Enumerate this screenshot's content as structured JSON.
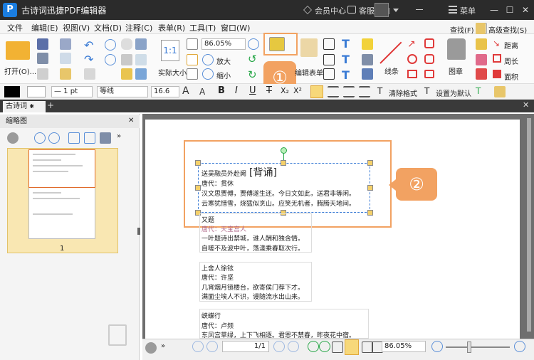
{
  "window": {
    "title": "古诗词迅捷PDF编辑器",
    "logo_text": "P",
    "member": "会员中心",
    "support": "客服入口",
    "menu_label": "菜单",
    "minimize": "—",
    "maximize": "☐",
    "close": "✕"
  },
  "menu": [
    "文件",
    "编辑(E)",
    "视图(V)",
    "文档(D)",
    "注释(C)",
    "表单(R)",
    "工具(T)",
    "窗口(W)"
  ],
  "ribbon": {
    "open_label": "打开(O)...",
    "actual_size_label": "实际大小",
    "zoom_value": "86.05%",
    "zoom_in_label": "放大",
    "zoom_out_label": "缩小",
    "edit_form_label": "编辑表单",
    "line_label": "线条",
    "stamp_label": "图章",
    "find_label": "查找(F)",
    "advanced_find_label": "高级查找(S)",
    "distance_label": "距离",
    "perimeter_label": "周长",
    "area_label": "面积",
    "callout_1": "①",
    "callout_2": "②"
  },
  "format": {
    "line_width": "— 1 pt",
    "font": "等线",
    "font_size": "16.6",
    "clear_format": "清除格式",
    "set_default": "设置为默认"
  },
  "tab": {
    "label": "古诗词",
    "add": "+"
  },
  "sidebar": {
    "title": "缩略图",
    "page_number": "1"
  },
  "document": {
    "poem1": {
      "title": "送吴融员外赴阙",
      "tag": "[背诵]",
      "author": "唐代：贯休",
      "line1": "汉文思贾傅，贾傅遂生还。今日文如此，送君非等闲。",
      "line2": "云寒犹惜雪，烧猛似烹山。应笑无机者，腾腾天地间。"
    },
    "poem2": {
      "title": "又题",
      "author": "唐代：天宝宫人",
      "line1": "一叶题诗出禁城，谁人酬和独含情。",
      "line2": "自嗟不及波中叶，荡漾乘春取次行。"
    },
    "poem3": {
      "title": "上舍人徐铉",
      "author": "唐代：许坚",
      "line1": "几宵烟月锁楼台，欲寄侯门荐下才。",
      "line2": "满面尘埃人不识，谩随流水出山来。"
    },
    "poem4": {
      "title": "蛱蝶行",
      "author": "唐代：卢频",
      "line1": "东风宫草绿，上下飞相逐。君恩不禁春，昨夜花中宿。"
    }
  },
  "status": {
    "page_value": "1/1",
    "zoom_value": "86.05%"
  }
}
